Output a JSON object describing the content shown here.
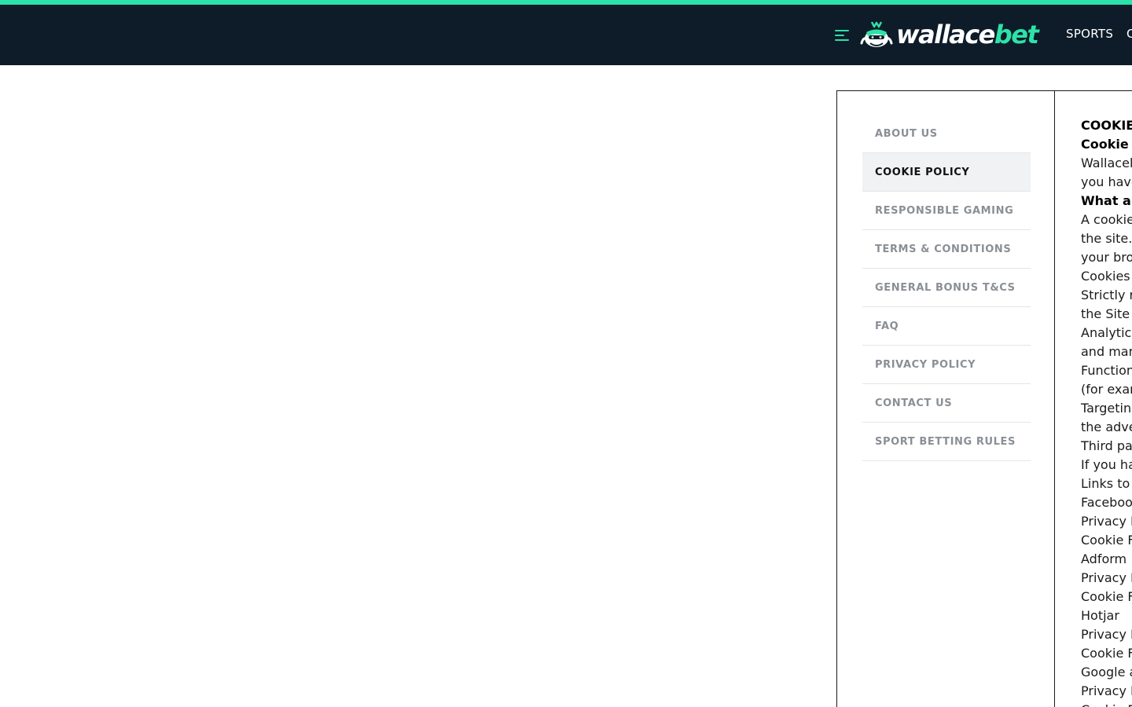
{
  "header": {
    "logo_text_main": "wallace",
    "logo_text_accent": "bet",
    "nav": [
      "SPORTS",
      "C"
    ]
  },
  "sidebar": {
    "items": [
      {
        "label": "ABOUT US",
        "active": false
      },
      {
        "label": "COOKIE POLICY",
        "active": true
      },
      {
        "label": "RESPONSIBLE GAMING",
        "active": false
      },
      {
        "label": "TERMS & CONDITIONS",
        "active": false
      },
      {
        "label": "GENERAL BONUS T&CS",
        "active": false
      },
      {
        "label": "FAQ",
        "active": false
      },
      {
        "label": "PRIVACY POLICY",
        "active": false
      },
      {
        "label": "CONTACT US",
        "active": false
      },
      {
        "label": "SPORT BETTING RULES",
        "active": false
      }
    ]
  },
  "content": {
    "lines": [
      {
        "text": "COOKIE",
        "bold": true
      },
      {
        "text": "Cookie",
        "bold": true
      },
      {
        "text": "Wallacel",
        "bold": false
      },
      {
        "text": "you have",
        "bold": false
      },
      {
        "text": "What a",
        "bold": true
      },
      {
        "text": "A cookie",
        "bold": false
      },
      {
        "text": "the site.",
        "bold": false
      },
      {
        "text": "your bro",
        "bold": false
      },
      {
        "text": "Cookies",
        "bold": false
      },
      {
        "text": "Strictly r",
        "bold": false
      },
      {
        "text": "the Site",
        "bold": false
      },
      {
        "text": "Analytic",
        "bold": false
      },
      {
        "text": "and man",
        "bold": false
      },
      {
        "text": "Function",
        "bold": false
      },
      {
        "text": "(for exar",
        "bold": false
      },
      {
        "text": "Targeting",
        "bold": false
      },
      {
        "text": "the adve",
        "bold": false
      },
      {
        "text": "Third pa",
        "bold": false
      },
      {
        "text": "If you ha",
        "bold": false
      },
      {
        "text": "Links to",
        "bold": false
      },
      {
        "text": "Faceboo",
        "bold": false
      },
      {
        "text": "Privacy I",
        "bold": false
      },
      {
        "text": "Cookie F",
        "bold": false
      },
      {
        "text": "Adform",
        "bold": false
      },
      {
        "text": "Privacy I",
        "bold": false
      },
      {
        "text": "Cookie F",
        "bold": false
      },
      {
        "text": "Hotjar",
        "bold": false
      },
      {
        "text": "Privacy I",
        "bold": false
      },
      {
        "text": "Cookie F",
        "bold": false
      },
      {
        "text": "Google a",
        "bold": false
      },
      {
        "text": "Privacy I",
        "bold": false
      },
      {
        "text": "Cookie F",
        "bold": false
      }
    ]
  },
  "colors": {
    "accent": "#2de2a8",
    "header_bg": "#0e1c29",
    "active_item_bg": "#f0f2f4",
    "inactive_item_text": "#8a8f96"
  },
  "icons": [
    "menu-icon",
    "wallace-mascot-icon"
  ]
}
